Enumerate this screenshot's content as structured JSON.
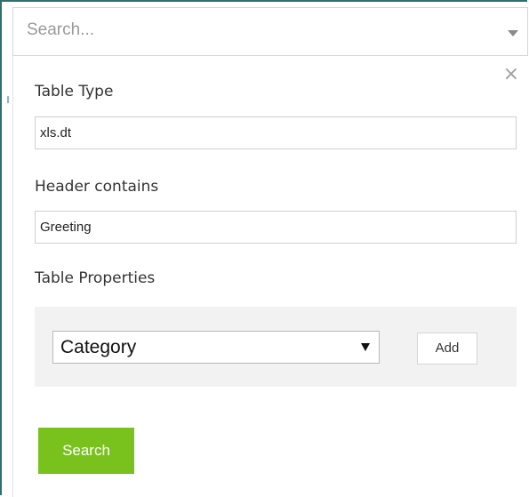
{
  "search": {
    "placeholder": "Search..."
  },
  "panel": {
    "close_glyph": "×",
    "table_type": {
      "label": "Table Type",
      "value": "xls.dt"
    },
    "header_contains": {
      "label": "Header contains",
      "value": "Greeting"
    },
    "table_properties": {
      "label": "Table Properties",
      "select_value": "Category",
      "add_label": "Add"
    },
    "search_button_label": "Search"
  },
  "colors": {
    "accent_green": "#79c21e",
    "frame_teal": "#2e6f6f",
    "props_bg": "#f2f2f2"
  },
  "icons": {
    "close": "close-icon",
    "dropdown": "chevron-down-icon"
  }
}
